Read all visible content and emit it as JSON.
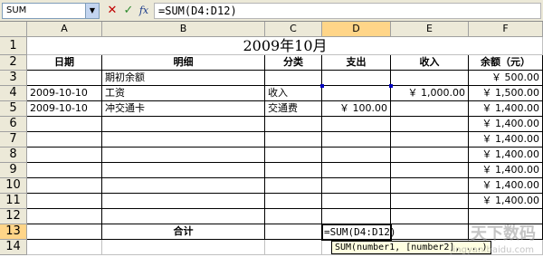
{
  "formula_bar": {
    "name_box": "SUM",
    "name_box_arrow": "▼",
    "cancel_symbol": "✕",
    "enter_symbol": "✓",
    "fx_symbol": "fx",
    "formula": "=SUM(D4:D12)"
  },
  "columns": [
    "A",
    "B",
    "C",
    "D",
    "E",
    "F"
  ],
  "rows": [
    "1",
    "2",
    "3",
    "4",
    "5",
    "6",
    "7",
    "8",
    "9",
    "10",
    "11",
    "12",
    "13",
    "14"
  ],
  "title": "2009年10月",
  "headers": {
    "date": "日期",
    "detail": "明细",
    "category": "分类",
    "expense": "支出",
    "income": "收入",
    "balance": "余额（元）"
  },
  "data_rows": [
    {
      "date": "",
      "detail": "期初余额",
      "category": "",
      "expense": "",
      "income": "",
      "balance": "￥    500.00"
    },
    {
      "date": "2009-10-10",
      "detail": "工资",
      "category": "收入",
      "expense": "",
      "income": "￥  1,000.00",
      "balance": "￥  1,500.00"
    },
    {
      "date": "2009-10-10",
      "detail": "冲交通卡",
      "category": "交通费",
      "expense": "￥  100.00",
      "income": "",
      "balance": "￥  1,400.00"
    },
    {
      "date": "",
      "detail": "",
      "category": "",
      "expense": "",
      "income": "",
      "balance": "￥  1,400.00"
    },
    {
      "date": "",
      "detail": "",
      "category": "",
      "expense": "",
      "income": "",
      "balance": "￥  1,400.00"
    },
    {
      "date": "",
      "detail": "",
      "category": "",
      "expense": "",
      "income": "",
      "balance": "￥  1,400.00"
    },
    {
      "date": "",
      "detail": "",
      "category": "",
      "expense": "",
      "income": "",
      "balance": "￥  1,400.00"
    },
    {
      "date": "",
      "detail": "",
      "category": "",
      "expense": "",
      "income": "",
      "balance": "￥  1,400.00"
    },
    {
      "date": "",
      "detail": "",
      "category": "",
      "expense": "",
      "income": "",
      "balance": "￥  1,400.00"
    }
  ],
  "total_label": "合计",
  "active_cell_formula": "=SUM(D4:D12)",
  "tooltip": "SUM(number1, [number2], ...)",
  "watermark": "天下数码",
  "watermark_sub": "jingyan.baidu.com"
}
